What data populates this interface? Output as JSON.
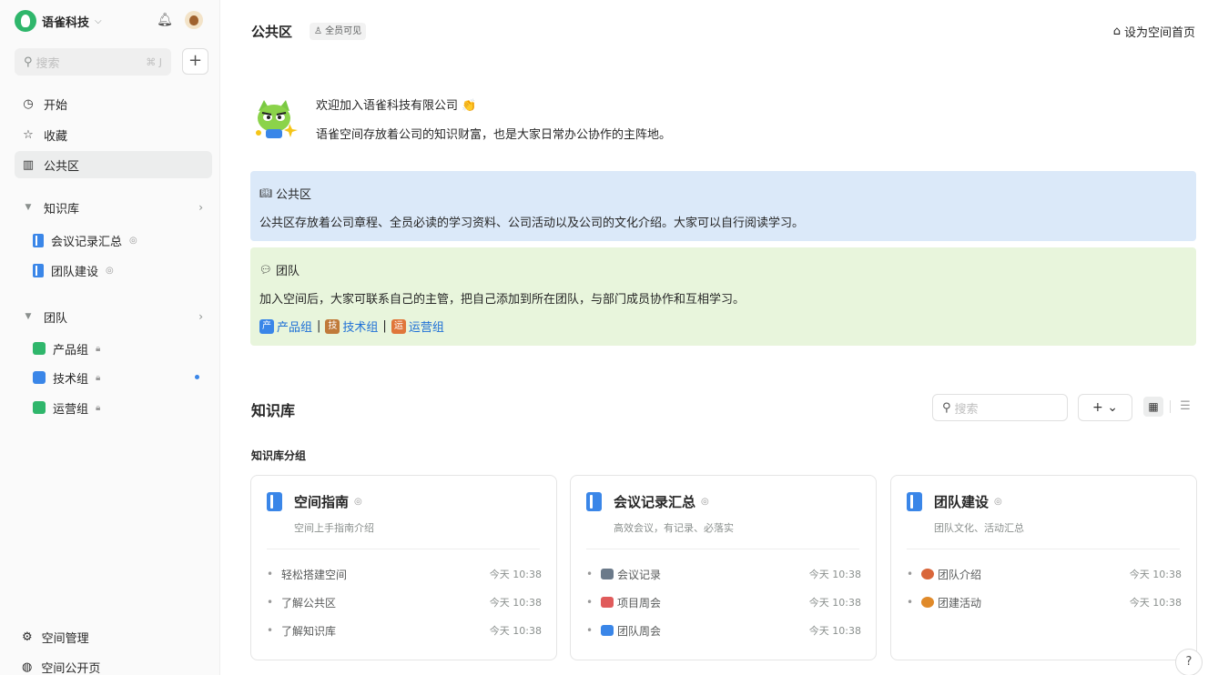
{
  "org": {
    "name": "语雀科技",
    "colors": {
      "logo": "#2fb66b"
    }
  },
  "sidebar": {
    "search": {
      "placeholder": "搜索",
      "shortcut": "⌘ J"
    },
    "nav": [
      {
        "label": "开始",
        "icon": "clock-icon"
      },
      {
        "label": "收藏",
        "icon": "star-icon"
      },
      {
        "label": "公共区",
        "icon": "library-icon"
      }
    ],
    "kb_section": {
      "label": "知识库"
    },
    "kb_items": [
      {
        "label": "会议记录汇总"
      },
      {
        "label": "团队建设"
      }
    ],
    "team_section": {
      "label": "团队"
    },
    "teams": [
      {
        "label": "产品组",
        "color": "#2fb66b"
      },
      {
        "label": "技术组",
        "color": "#3a86e8"
      },
      {
        "label": "运营组",
        "color": "#2fb66b"
      }
    ],
    "bottom": [
      {
        "label": "空间管理",
        "icon": "gear-icon"
      },
      {
        "label": "空间公开页",
        "icon": "globe-icon"
      }
    ]
  },
  "header": {
    "title": "公共区",
    "visibility": "全员可见",
    "set_home": "设为空间首页"
  },
  "welcome": {
    "line1": "欢迎加入语雀科技有限公司 👏",
    "line2": "语雀空间存放着公司的知识财富，也是大家日常办公协作的主阵地。"
  },
  "panels": {
    "public": {
      "heading": "公共区",
      "body": "公共区存放着公司章程、全员必读的学习资料、公司活动以及公司的文化介绍。大家可以自行阅读学习。"
    },
    "team": {
      "heading": "团队",
      "body": "加入空间后，大家可联系自己的主管，把自己添加到所在团队，与部门成员协作和互相学习。",
      "links": [
        {
          "tag": "产",
          "label": "产品组",
          "color": "#3a86e8"
        },
        {
          "tag": "技",
          "label": "技术组",
          "color": "#c07a3a"
        },
        {
          "tag": "运",
          "label": "运营组",
          "color": "#e0763a"
        }
      ],
      "separator": "|"
    }
  },
  "kb": {
    "title": "知识库",
    "search_placeholder": "搜索",
    "add_label": "+ ⌄",
    "group_label": "知识库分组",
    "cards": [
      {
        "title": "空间指南",
        "desc": "空间上手指南介绍",
        "docs": [
          {
            "title": "轻松搭建空间",
            "time": "今天 10:38"
          },
          {
            "title": "了解公共区",
            "time": "今天 10:38"
          },
          {
            "title": "了解知识库",
            "time": "今天 10:38"
          }
        ]
      },
      {
        "title": "会议记录汇总",
        "desc": "高效会议，有记录、必落实",
        "docs": [
          {
            "title": "会议记录",
            "time": "今天 10:38",
            "emoji_color": "#6b7a8a"
          },
          {
            "title": "项目周会",
            "time": "今天 10:38",
            "emoji_color": "#e05b5b"
          },
          {
            "title": "团队周会",
            "time": "今天 10:38",
            "emoji_color": "#3a86e8"
          }
        ]
      },
      {
        "title": "团队建设",
        "desc": "团队文化、活动汇总",
        "docs": [
          {
            "title": "团队介绍",
            "time": "今天 10:38",
            "emoji_color": "#d9663a"
          },
          {
            "title": "团建活动",
            "time": "今天 10:38",
            "emoji_color": "#e08a2a"
          }
        ]
      }
    ]
  }
}
